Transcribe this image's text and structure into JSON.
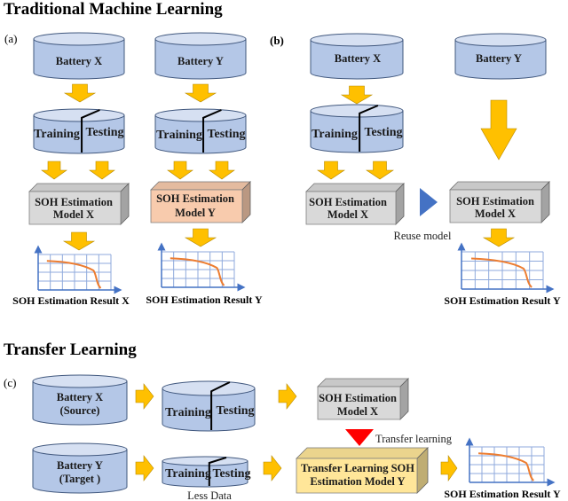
{
  "titles": {
    "traditional": "Traditional Machine Learning",
    "transfer": "Transfer Learning"
  },
  "panels": {
    "a": "(a)",
    "b": "(b)",
    "c": "(c)"
  },
  "labels": {
    "battery_x": "Battery X",
    "battery_y": "Battery Y",
    "battery_x_source_1": "Battery X",
    "battery_x_source_2": "(Source)",
    "battery_y_target_1": "Battery Y",
    "battery_y_target_2": "(Target )",
    "training": "Training",
    "testing": "Testing",
    "model_line1": "SOH Estimation",
    "model_x_line2": "Model X",
    "model_y_line2": "Model Y",
    "tl_model_line1": "Transfer Learning SOH",
    "tl_model_line2": "Estimation Model Y",
    "result_x": "SOH Estimation Result X",
    "result_y": "SOH Estimation Result Y",
    "reuse_model": "Reuse model",
    "transfer_learning": "Transfer learning",
    "less_data": "Less Data"
  },
  "colors": {
    "cylinder_fill": "#b4c7e7",
    "cylinder_top": "#d6e0f2",
    "cylinder_stroke": "#41587e",
    "arrow": "#ffc000",
    "arrow_stroke": "#b88a00",
    "box_gray": "#d9d9d9",
    "box_peach": "#f8cbad",
    "box_yellow": "#ffe699",
    "reuse_triangle": "#4472c4",
    "transfer_triangle": "#ff0000",
    "grid": "#8faadc",
    "axis": "#4472c4",
    "curve": "#ed7d31"
  }
}
